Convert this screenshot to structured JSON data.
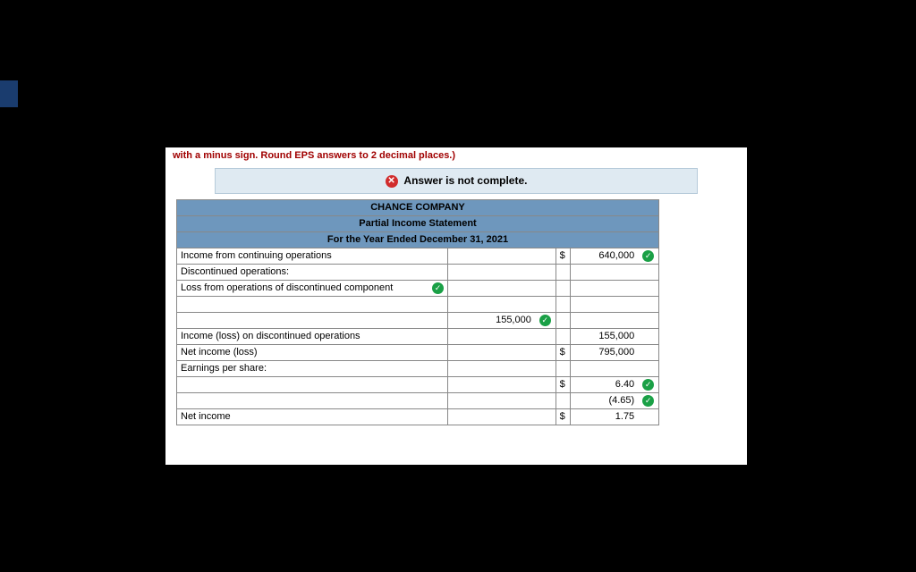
{
  "instruction_fragment": "with a minus sign. Round EPS answers to 2 decimal places.)",
  "alert": {
    "text": "Answer is not complete."
  },
  "header": {
    "company": "CHANCE COMPANY",
    "title": "Partial Income Statement",
    "period": "For the Year Ended December 31, 2021"
  },
  "rows": {
    "r1": {
      "label": "Income from continuing operations",
      "cur": "$",
      "amt": "640,000",
      "tick": true
    },
    "r2": {
      "label": "Discontinued operations:"
    },
    "r3": {
      "label": "Loss from operations of discontinued component",
      "label_tick": true
    },
    "r4": {},
    "r5": {
      "mid": "155,000",
      "mid_tick": true
    },
    "r6": {
      "label": "Income (loss) on discontinued operations",
      "amt": "155,000"
    },
    "r7": {
      "label": "Net income (loss)",
      "cur": "$",
      "amt": "795,000"
    },
    "r8": {
      "label": "Earnings per share:"
    },
    "r9": {
      "cur": "$",
      "amt": "6.40",
      "tick": true
    },
    "r10": {
      "amt": "(4.65)",
      "tick": true
    },
    "r11": {
      "label": "Net income",
      "cur": "$",
      "amt": "1.75"
    }
  }
}
